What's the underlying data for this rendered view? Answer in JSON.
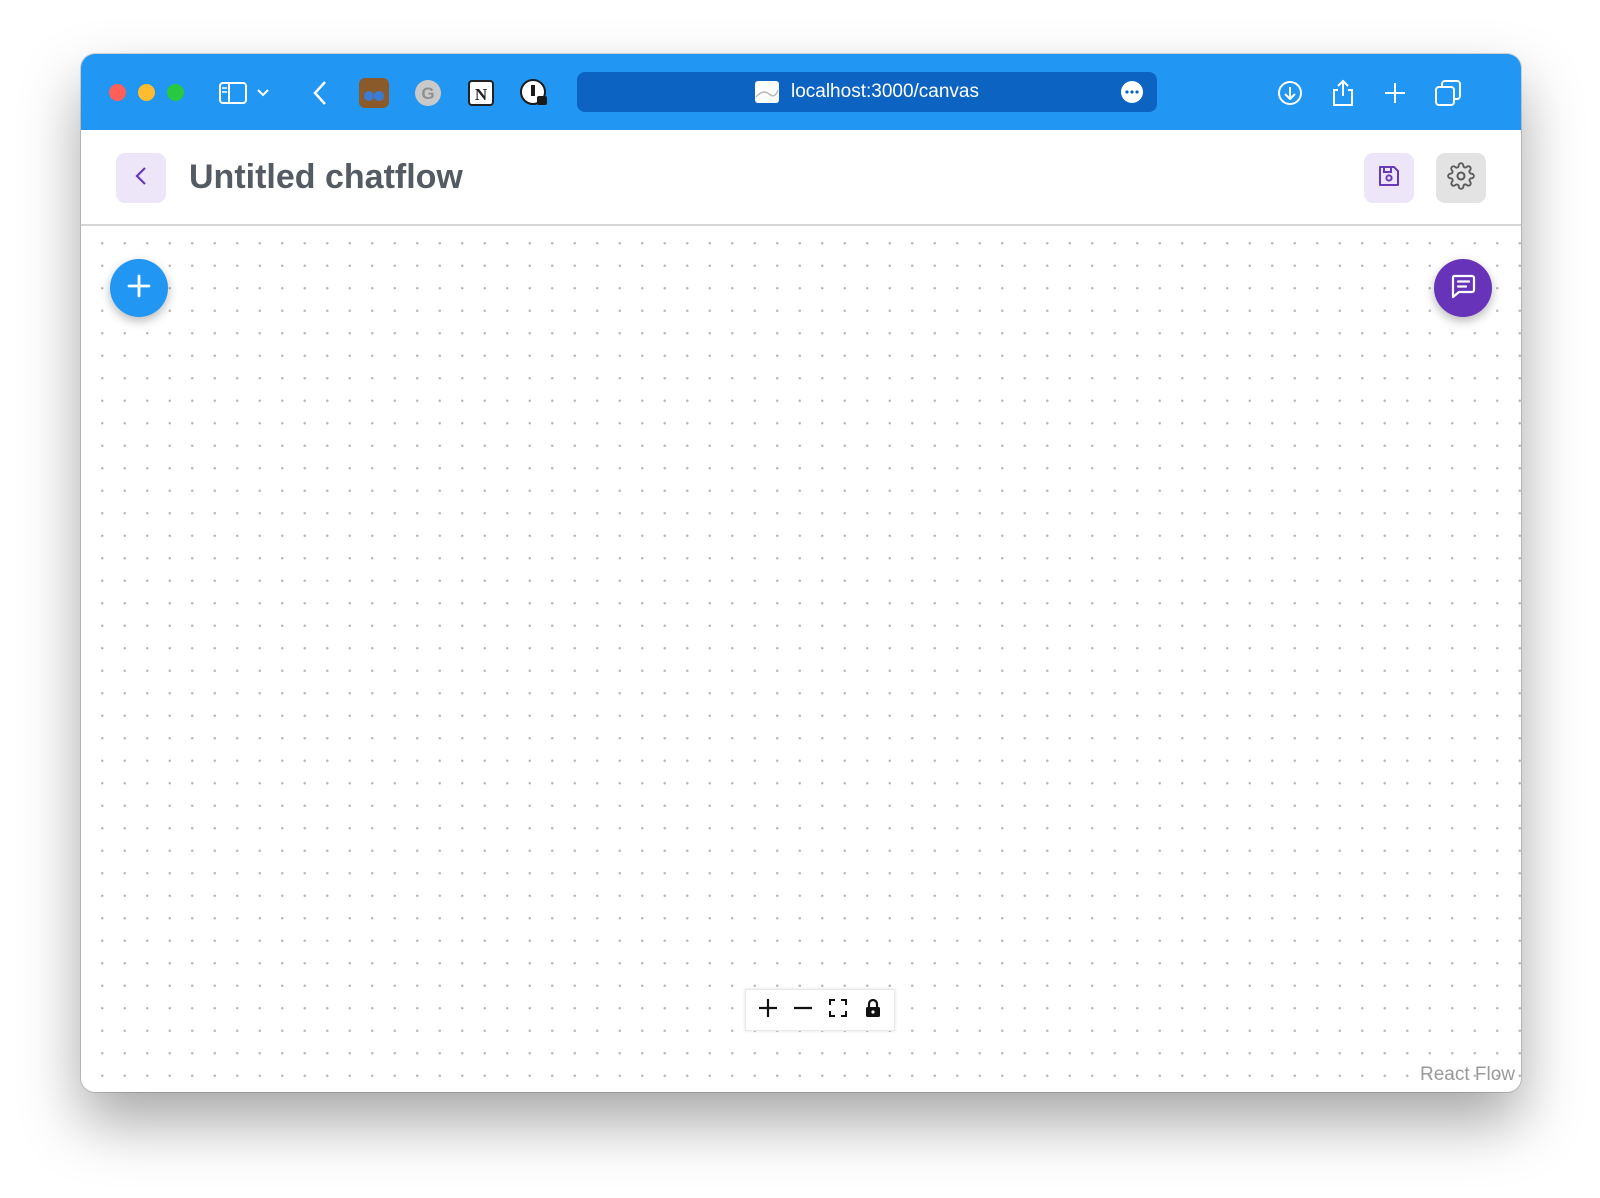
{
  "browser": {
    "url": "localhost:3000/canvas"
  },
  "header": {
    "title": "Untitled chatflow"
  },
  "canvas": {
    "attribution": "React Flow"
  },
  "colors": {
    "toolbar": "#2196f3",
    "address_bar": "#0d63c2",
    "add_fab": "#2196f3",
    "chat_fab": "#6733b9",
    "accent_purple": "#673ab7"
  },
  "icons": {
    "back": "chevron-left-icon",
    "save": "save-icon",
    "settings": "gear-icon",
    "add": "plus-icon",
    "chat": "chat-icon",
    "zoom_in": "plus-icon",
    "zoom_out": "minus-icon",
    "fit_view": "fit-view-icon",
    "lock": "lock-icon"
  }
}
